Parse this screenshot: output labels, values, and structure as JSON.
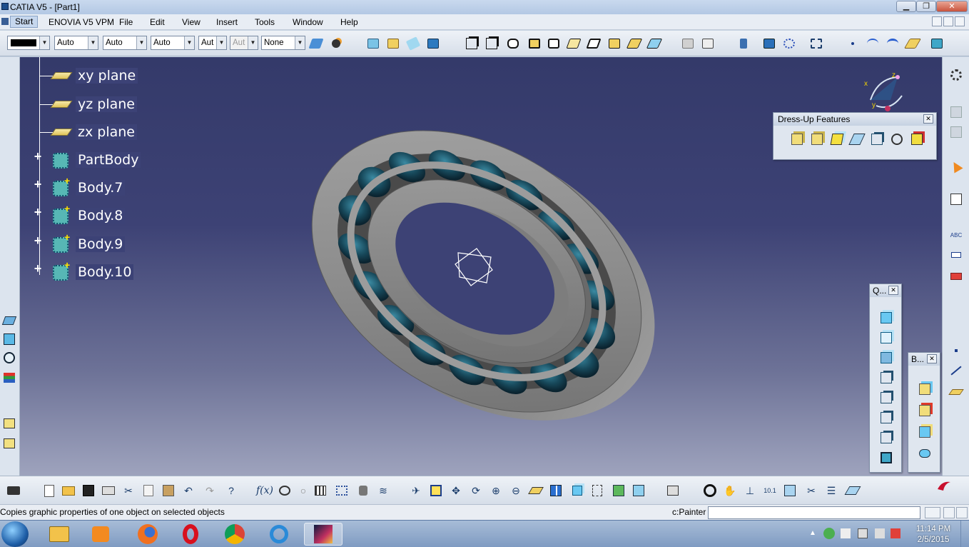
{
  "window": {
    "title": "CATIA V5 - [Part1]",
    "minimize_glyph": "▁",
    "restore_glyph": "❐",
    "close_glyph": "✕"
  },
  "menu": {
    "items": [
      "Start",
      "ENOVIA V5 VPM",
      "File",
      "Edit",
      "View",
      "Insert",
      "Tools",
      "Window",
      "Help"
    ]
  },
  "toolbar": {
    "combos": [
      {
        "value": "",
        "disabled": false
      },
      {
        "value": "Auto",
        "disabled": false
      },
      {
        "value": "Auto",
        "disabled": false
      },
      {
        "value": "Auto",
        "disabled": false
      },
      {
        "value": "Aut",
        "disabled": false
      },
      {
        "value": "Aut",
        "disabled": true
      },
      {
        "value": "None",
        "disabled": false
      }
    ]
  },
  "tree": {
    "planes": [
      "xy plane",
      "yz plane",
      "zx plane"
    ],
    "bodies": [
      "PartBody",
      "Body.7",
      "Body.8",
      "Body.9",
      "Body.10"
    ]
  },
  "compass": {
    "x_label": "x",
    "y_label": "y",
    "z_label": "z"
  },
  "dressup": {
    "title": "Dress-Up Features",
    "icons": [
      "fillet-icon",
      "chamfer-icon",
      "draft-icon",
      "shell-icon",
      "thickness-icon",
      "thread-icon",
      "remove-face-icon"
    ]
  },
  "quick_view": {
    "title": "Q...",
    "icon_count": 8
  },
  "bodies_panel": {
    "title": "B...",
    "icon_count": 4
  },
  "status": {
    "message": "Copies graphic properties of one object on selected objects",
    "command_label": "c:Painter"
  },
  "taskbar": {
    "time": "11:14 PM",
    "date": "2/5/2015",
    "apps": [
      "explorer-icon",
      "media-player-icon",
      "firefox-icon",
      "opera-icon",
      "chrome-icon",
      "internet-explorer-icon",
      "catia-icon"
    ]
  },
  "colors": {
    "viewport_top": "#343a6a",
    "viewport_bottom": "#9ea3bd",
    "tree_bar": "#5b62b8",
    "bearing_gray": "#8a8a8a",
    "ball_teal": "#1e5a6e"
  }
}
